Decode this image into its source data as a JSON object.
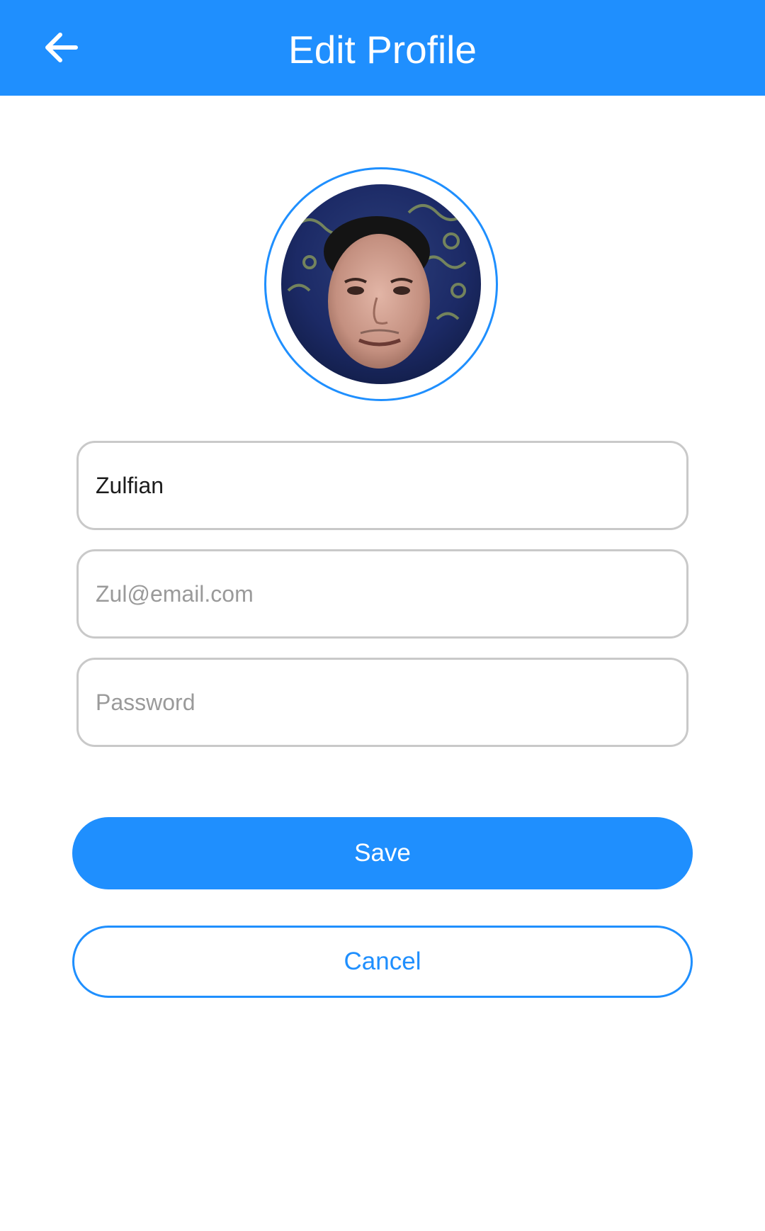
{
  "header": {
    "title": "Edit Profile",
    "back_icon": "arrow-left-icon",
    "background_color": "#1f8ffe"
  },
  "profile": {
    "avatar_icon": "user-photo"
  },
  "form": {
    "name_value": "Zulfian",
    "email_placeholder": "Zul@email.com",
    "password_placeholder": "Password"
  },
  "actions": {
    "save_label": "Save",
    "cancel_label": "Cancel"
  },
  "colors": {
    "accent": "#1f8ffe",
    "field_border": "#c9c9c9",
    "placeholder": "#9a9a9a"
  }
}
